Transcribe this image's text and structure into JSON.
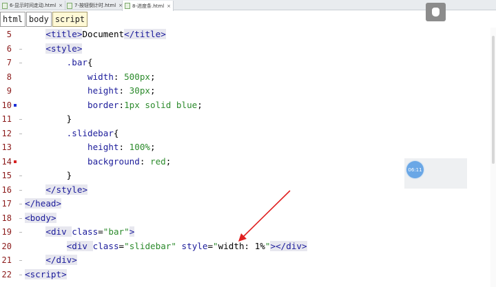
{
  "tabs": [
    {
      "label": "6-显示时间走动.html",
      "close": "×",
      "file_icon": "html-file-icon",
      "active": false
    },
    {
      "label": "7-按钮倒计时.html",
      "close": "×",
      "file_icon": "html-file-icon",
      "active": false
    },
    {
      "label": "8-进度条.html",
      "close": "×",
      "file_icon": "html-file-icon",
      "active": true
    }
  ],
  "breadcrumb": [
    "html",
    "body",
    "script"
  ],
  "timer": {
    "value": "06:11"
  },
  "colors": {
    "line_number": "#8b1a1a",
    "tag": "#1b1b9a",
    "value": "#2b8a2b",
    "marker": "#1c2fd6",
    "marker_error": "#d62222",
    "arrow": "#e02020"
  },
  "lines": [
    {
      "num": "5",
      "tokens": [
        [
          "indent",
          "    "
        ],
        [
          "tag",
          "<"
        ],
        [
          "tag",
          "title"
        ],
        [
          "tag",
          ">"
        ],
        [
          "plain",
          "Document"
        ],
        [
          "tag",
          "</"
        ],
        [
          "tag",
          "title"
        ],
        [
          "tag",
          ">"
        ]
      ]
    },
    {
      "num": "6",
      "tokens": [
        [
          "indent",
          "    "
        ],
        [
          "tag",
          "<"
        ],
        [
          "tag",
          "style"
        ],
        [
          "tag",
          ">"
        ]
      ]
    },
    {
      "num": "7",
      "tokens": [
        [
          "indent",
          "        "
        ],
        [
          "sel",
          ".bar"
        ],
        [
          "plain",
          "{"
        ]
      ]
    },
    {
      "num": "8",
      "tokens": [
        [
          "indent",
          "            "
        ],
        [
          "prop",
          "width"
        ],
        [
          "plain",
          ": "
        ],
        [
          "val",
          "500px"
        ],
        [
          "plain",
          ";"
        ]
      ]
    },
    {
      "num": "9",
      "tokens": [
        [
          "indent",
          "            "
        ],
        [
          "prop",
          "height"
        ],
        [
          "plain",
          ": "
        ],
        [
          "val",
          "30px"
        ],
        [
          "plain",
          ";"
        ]
      ]
    },
    {
      "num": "10",
      "tokens": [
        [
          "indent",
          "            "
        ],
        [
          "prop",
          "border"
        ],
        [
          "plain",
          ":"
        ],
        [
          "val",
          "1px solid blue"
        ],
        [
          "plain",
          ";"
        ]
      ]
    },
    {
      "num": "11",
      "tokens": [
        [
          "indent",
          "        "
        ],
        [
          "plain",
          "}"
        ]
      ]
    },
    {
      "num": "12",
      "tokens": [
        [
          "indent",
          "        "
        ],
        [
          "sel",
          ".slidebar"
        ],
        [
          "plain",
          "{"
        ]
      ]
    },
    {
      "num": "13",
      "tokens": [
        [
          "indent",
          "            "
        ],
        [
          "prop",
          "height"
        ],
        [
          "plain",
          ": "
        ],
        [
          "val",
          "100%"
        ],
        [
          "plain",
          ";"
        ]
      ]
    },
    {
      "num": "14",
      "tokens": [
        [
          "indent",
          "            "
        ],
        [
          "prop",
          "background"
        ],
        [
          "plain",
          ": "
        ],
        [
          "val",
          "red"
        ],
        [
          "plain",
          ";"
        ]
      ]
    },
    {
      "num": "15",
      "tokens": [
        [
          "indent",
          "        "
        ],
        [
          "plain",
          "}"
        ]
      ]
    },
    {
      "num": "16",
      "tokens": [
        [
          "indent",
          "    "
        ],
        [
          "tag",
          "</"
        ],
        [
          "tag",
          "style"
        ],
        [
          "tag",
          ">"
        ]
      ]
    },
    {
      "num": "17",
      "tokens": [
        [
          "tag",
          "</"
        ],
        [
          "tag",
          "head"
        ],
        [
          "tag",
          ">"
        ]
      ]
    },
    {
      "num": "18",
      "tokens": [
        [
          "tag",
          "<"
        ],
        [
          "tag",
          "body"
        ],
        [
          "tag",
          ">"
        ]
      ]
    },
    {
      "num": "19",
      "tokens": [
        [
          "indent",
          "    "
        ],
        [
          "tag",
          "<"
        ],
        [
          "tag",
          "div "
        ],
        [
          "tagtext",
          "class"
        ],
        [
          "plain",
          "="
        ],
        [
          "str",
          "\"bar\""
        ],
        [
          "tag",
          ">"
        ]
      ]
    },
    {
      "num": "20",
      "tokens": [
        [
          "indent",
          "        "
        ],
        [
          "tag",
          "<"
        ],
        [
          "tag",
          "div "
        ],
        [
          "tagtext",
          "class"
        ],
        [
          "plain",
          "="
        ],
        [
          "str",
          "\"slidebar\""
        ],
        [
          "tagtext",
          " style"
        ],
        [
          "plain",
          "="
        ],
        [
          "str",
          "\""
        ],
        [
          "plain",
          "width: 1%"
        ],
        [
          "str",
          "\""
        ],
        [
          "tag",
          ">"
        ],
        [
          "tag",
          "</"
        ],
        [
          "tag",
          "div"
        ],
        [
          "tag",
          ">"
        ]
      ]
    },
    {
      "num": "21",
      "tokens": [
        [
          "indent",
          "    "
        ],
        [
          "tag",
          "</"
        ],
        [
          "tag",
          "div"
        ],
        [
          "tag",
          ">"
        ]
      ]
    },
    {
      "num": "22",
      "tokens": [
        [
          "tag",
          "<"
        ],
        [
          "tag",
          "script"
        ],
        [
          "tag",
          ">"
        ]
      ]
    }
  ]
}
